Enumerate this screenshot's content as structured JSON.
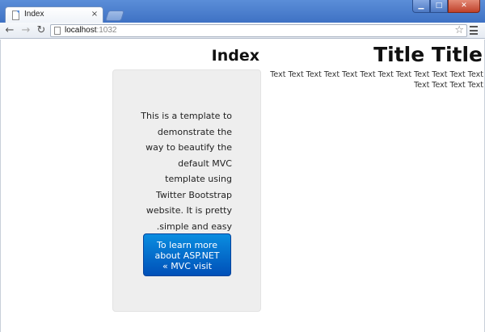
{
  "browser": {
    "tab_title": "Index",
    "tab_close": "×",
    "url_host": "localhost",
    "url_port": ":1032",
    "window_controls": {
      "minimize": "▁",
      "maximize": "□",
      "close": "✕"
    },
    "nav": {
      "back": "←",
      "forward": "→",
      "reload": "↻"
    },
    "star": "☆"
  },
  "page": {
    "index_heading": "Index",
    "well_text": "This is a template to demonstrate the way to beautify the default MVC template using Twitter Bootstrap website. It is pretty simple and easy.",
    "learn_button_label": "To learn more about ASP.NET MVC visit »",
    "title_heading": "Title Title",
    "title_body": "Text Text Text Text Text Text Text Text Text Text Text Text Text Text Text Text"
  }
}
